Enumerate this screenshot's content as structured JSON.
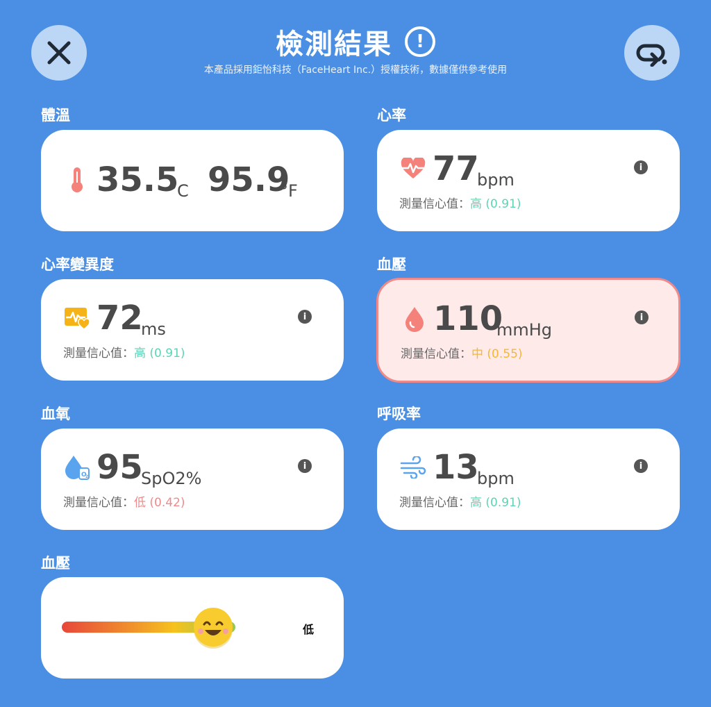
{
  "header": {
    "title": "檢測結果",
    "subtitle": "本產品採用鉅怡科技（FaceHeart Inc.）授權技術，數據僅供參考使用"
  },
  "colors": {
    "background": "#4a8fe3",
    "confidence_high": "#5fd3b3",
    "confidence_mid": "#f5b733",
    "confidence_low": "#f08a8a",
    "alert_bg": "#ffeaea",
    "alert_border": "#f08a8a"
  },
  "icons": {
    "close": "close-icon",
    "retry": "retry-icon",
    "header_info": "exclamation-circle-icon",
    "temperature": "thermometer-icon",
    "heart_rate": "heart-pulse-icon",
    "hrv": "heartbeat-monitor-icon",
    "blood_pressure": "blood-drop-icon",
    "spo2": "oxygen-drop-icon",
    "respiration": "wind-icon",
    "info": "info-icon",
    "bp_face": "smiling-face-icon"
  },
  "temperature": {
    "label": "體溫",
    "celsius": "35.5",
    "celsius_unit": "°C",
    "fahrenheit": "95.9",
    "fahrenheit_unit": "°F"
  },
  "heart_rate": {
    "label": "心率",
    "value": "77",
    "unit": "bpm",
    "confidence_prefix": "測量信心值：",
    "confidence_text": "高 (0.91)"
  },
  "hrv": {
    "label": "心率變異度",
    "value": "72",
    "unit": "ms",
    "confidence_prefix": "測量信心值：",
    "confidence_text": "高 (0.91)"
  },
  "blood_pressure": {
    "label": "血壓",
    "value": "110",
    "unit": "mmHg",
    "confidence_prefix": "測量信心值：",
    "confidence_text": "中 (0.55)"
  },
  "spo2": {
    "label": "血氧",
    "value": "95",
    "unit": "SpO2%",
    "confidence_prefix": "測量信心值：",
    "confidence_text": "低 (0.42)"
  },
  "respiration": {
    "label": "呼吸率",
    "value": "13",
    "unit": "bpm",
    "confidence_prefix": "測量信心值：",
    "confidence_text": "高 (0.91)"
  },
  "bp_level": {
    "label": "血壓",
    "level_text": "低",
    "indicator_fraction": 0.87
  }
}
